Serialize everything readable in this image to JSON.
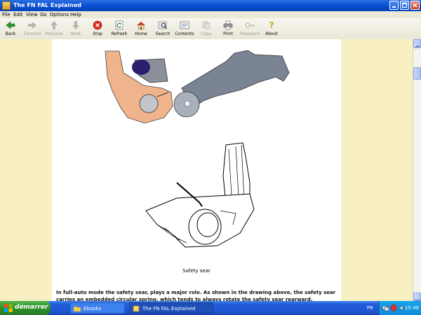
{
  "window": {
    "title": "The FN FAL Explained"
  },
  "menu": [
    "File",
    "Edit",
    "View",
    "Go",
    "Options",
    "Help"
  ],
  "toolbar": [
    {
      "label": "Back",
      "icon": "back-arrow-icon",
      "enabled": true
    },
    {
      "label": "Forward",
      "icon": "forward-arrow-icon",
      "enabled": false
    },
    {
      "label": "Previous",
      "icon": "previous-arrow-icon",
      "enabled": false
    },
    {
      "label": "Next",
      "icon": "next-arrow-icon",
      "enabled": false
    },
    {
      "label": "Stop",
      "icon": "stop-icon",
      "enabled": true
    },
    {
      "label": "Refresh",
      "icon": "refresh-icon",
      "enabled": true
    },
    {
      "label": "Home",
      "icon": "home-icon",
      "enabled": true
    },
    {
      "label": "Search",
      "icon": "search-icon",
      "enabled": true
    },
    {
      "label": "Contents",
      "icon": "contents-icon",
      "enabled": true
    },
    {
      "label": "Copy",
      "icon": "copy-icon",
      "enabled": false
    },
    {
      "label": "Print",
      "icon": "print-icon",
      "enabled": true
    },
    {
      "label": "Password",
      "icon": "password-icon",
      "enabled": false
    },
    {
      "label": "About",
      "icon": "about-icon",
      "enabled": true
    }
  ],
  "content": {
    "caption": "Safety sear",
    "body_text": "In full-auto mode the safety sear, plays a major role. As shown in the drawing above, the safety sear carries an embedded circular spring, which tends to always rotate the safety sear rearward."
  },
  "taskbar": {
    "start_label": "démarrer",
    "tasks": [
      {
        "label": "Ebooks",
        "icon": "folder-icon"
      },
      {
        "label": "The FN FAL Explained",
        "icon": "ebook-icon"
      }
    ],
    "language": "FR",
    "clock": "15:49"
  },
  "colors": {
    "page_background": "#f8efc2",
    "part_orange": "#f0b48c",
    "part_gray": "#7b8494",
    "part_navy": "#2a1f6e"
  }
}
